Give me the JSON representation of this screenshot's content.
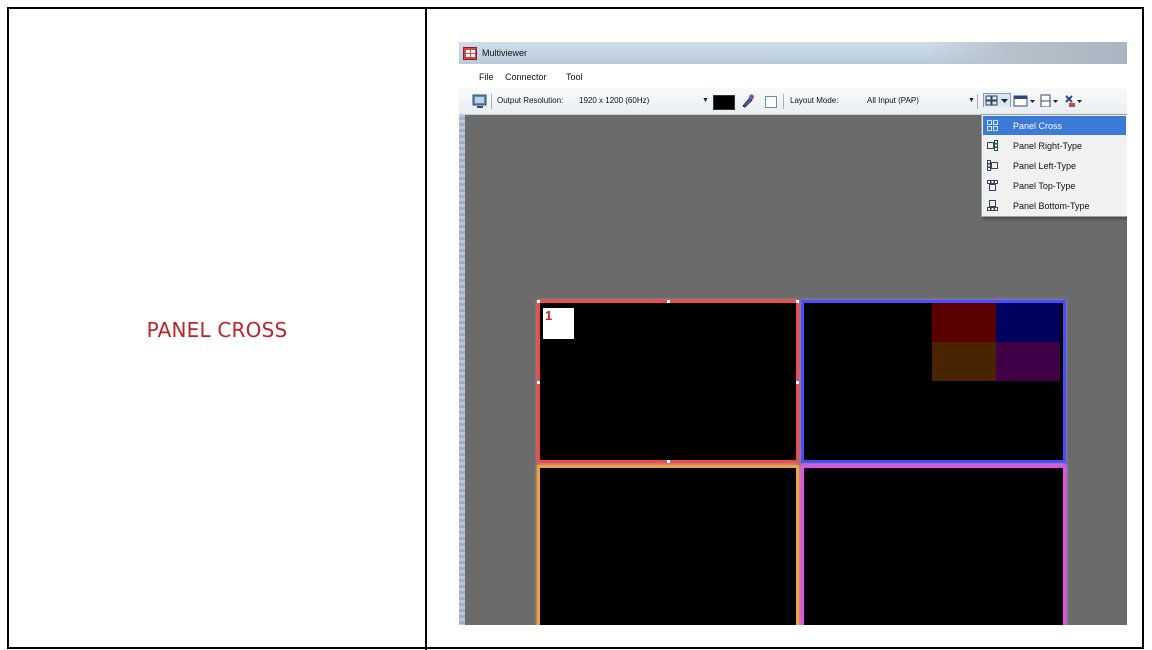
{
  "caption": "PANEL CROSS",
  "window": {
    "title": "Multiviewer",
    "menu": [
      "File",
      "Connector",
      "Tool"
    ]
  },
  "toolbar": {
    "output_resolution_label": "Output Resolution:",
    "output_resolution_value": "1920 x 1200 (60Hz)",
    "layout_mode_label": "Layout Mode:",
    "layout_mode_value": "All Input (PAP)"
  },
  "layout_menu": {
    "items": [
      "Panel Cross",
      "Panel Right-Type",
      "Panel Left-Type",
      "Panel Top-Type",
      "Panel Bottom-Type"
    ],
    "selected": "Panel Cross"
  },
  "panels": [
    {
      "label": "1",
      "border_color": "#ee4b4b"
    },
    {
      "label": "",
      "border_color": "#4b4bff"
    },
    {
      "label": "",
      "border_color": "#f4a042"
    },
    {
      "label": "",
      "border_color": "#e84cf0"
    }
  ],
  "colors": {
    "caption": "#c0222a",
    "canvas": "#6b6b6b",
    "menu_selection": "#3b7ad6",
    "tile_red": "#5a0000",
    "tile_navy": "#00005e",
    "tile_brown": "#4a2300",
    "tile_purple": "#3f0045"
  }
}
